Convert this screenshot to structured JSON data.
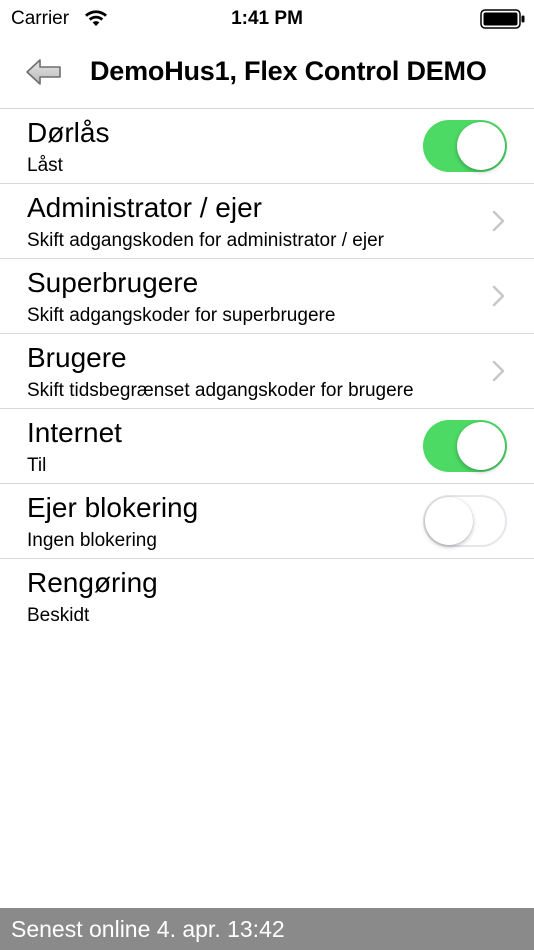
{
  "status_bar": {
    "carrier": "Carrier",
    "time": "1:41 PM",
    "wifi_icon": "wifi-icon",
    "battery_icon": "battery-icon"
  },
  "nav": {
    "title": "DemoHus1, Flex Control DEMO",
    "back_icon": "back-arrow-icon"
  },
  "rows": [
    {
      "title": "Dørlås",
      "subtitle": "Låst",
      "control": "toggle",
      "on": true
    },
    {
      "title": "Administrator / ejer",
      "subtitle": "Skift adgangskoden for administrator / ejer",
      "control": "chevron"
    },
    {
      "title": "Superbrugere",
      "subtitle": "Skift adgangskoder for superbrugere",
      "control": "chevron"
    },
    {
      "title": "Brugere",
      "subtitle": "Skift tidsbegrænset adgangskoder for brugere",
      "control": "chevron"
    },
    {
      "title": "Internet",
      "subtitle": "Til",
      "control": "toggle",
      "on": true
    },
    {
      "title": "Ejer blokering",
      "subtitle": "Ingen blokering",
      "control": "toggle",
      "on": false
    },
    {
      "title": "Rengøring",
      "subtitle": "Beskidt",
      "control": "none"
    }
  ],
  "footer": {
    "text": "Senest online 4. apr. 13:42"
  },
  "colors": {
    "toggle_on": "#4cd964",
    "footer_bg": "#8a8a8a",
    "separator": "#d8d8d8",
    "chevron": "#c7c7cc"
  }
}
